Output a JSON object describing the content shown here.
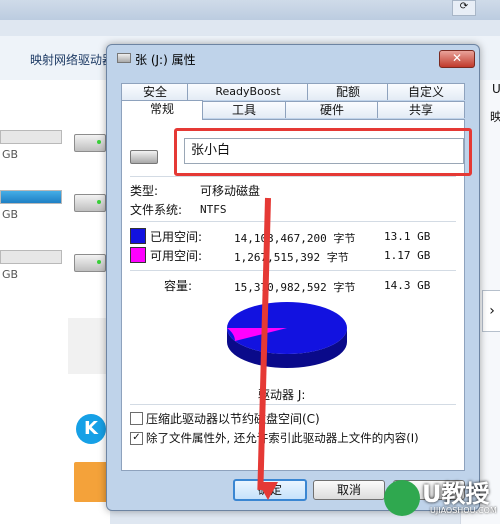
{
  "background": {
    "map_drive_label": "映射网络驱动器",
    "gb_label": "GB",
    "right_peek_1": "U",
    "right_peek_2": "映",
    "arrow_glyph": "›"
  },
  "dialog": {
    "title": "张 (J:) 属性",
    "close_glyph": "✕",
    "tabs_row1": [
      "安全",
      "ReadyBoost",
      "配额",
      "自定义"
    ],
    "tabs_row2": [
      "常规",
      "工具",
      "硬件",
      "共享"
    ],
    "name_value": "张小白",
    "type_label": "类型:",
    "type_value": "可移动磁盘",
    "fs_label": "文件系统:",
    "fs_value": "NTFS",
    "used_label": "已用空间:",
    "used_bytes": "14,103,467,200 字节",
    "used_size": "13.1 GB",
    "free_label": "可用空间:",
    "free_bytes": "1,267,515,392 字节",
    "free_size": "1.17 GB",
    "capacity_label": "容量:",
    "capacity_bytes": "15,370,982,592 字节",
    "capacity_size": "14.3 GB",
    "drive_label": "驱动器 J:",
    "compress_label": "压缩此驱动器以节约磁盘空间(C)",
    "index_label": "除了文件属性外, 还允许索引此驱动器上文件的内容(I)",
    "compress_checked": false,
    "index_checked": true,
    "ok_label": "确定",
    "cancel_label": "取消",
    "used_fraction": 0.917,
    "colors": {
      "used": "#1212e0",
      "free": "#ff00ff",
      "accent": "#e53935"
    }
  },
  "watermark": {
    "text": "U教授",
    "sub": "UJIAOSHOU.COM"
  }
}
